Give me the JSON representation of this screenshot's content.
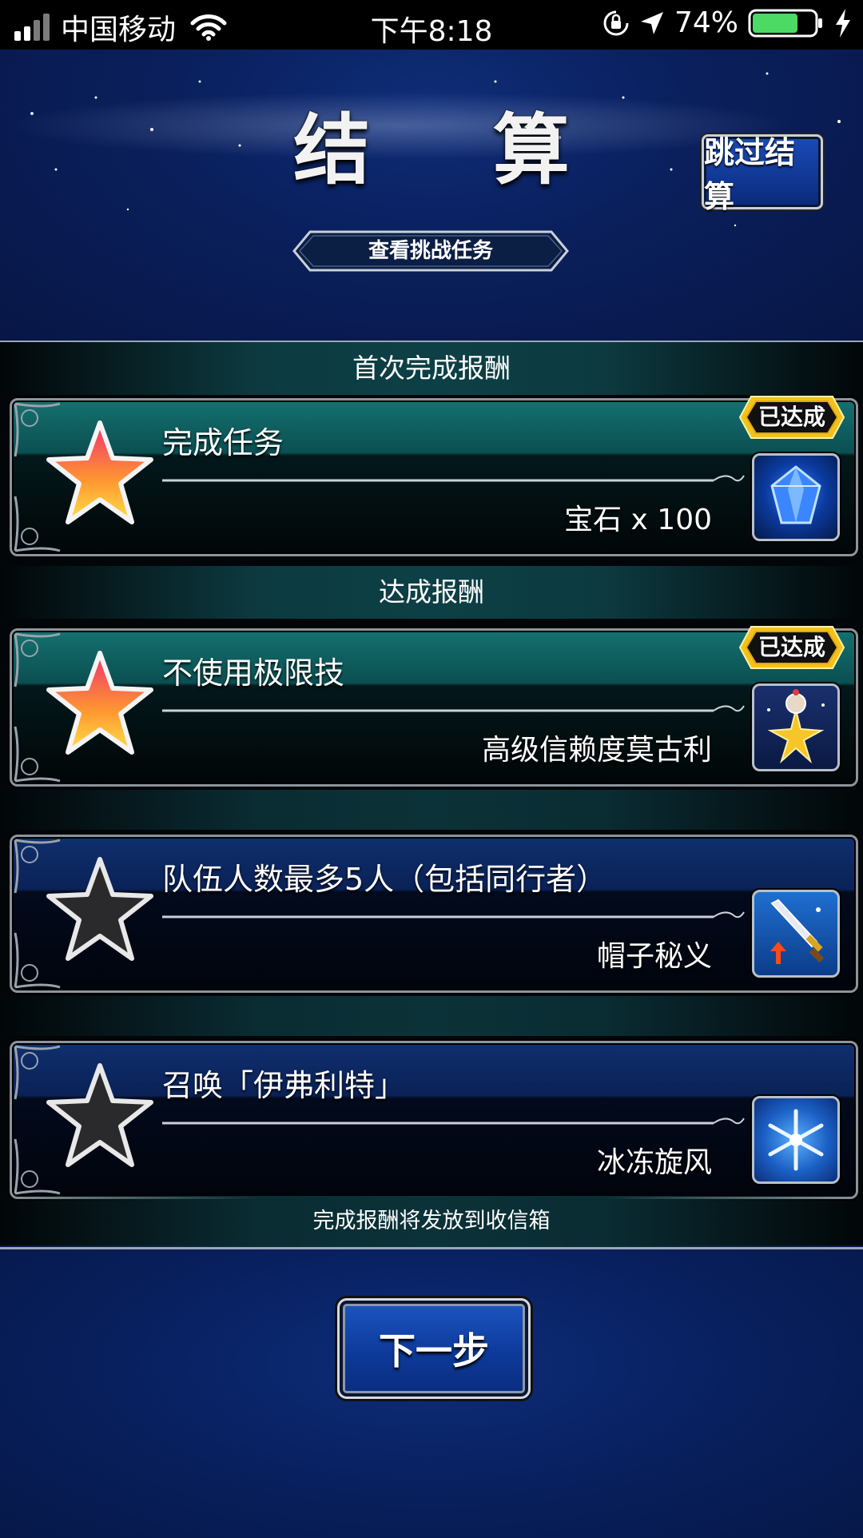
{
  "status_bar": {
    "carrier": "中国移动",
    "time": "下午8:18",
    "battery": "74%",
    "battery_level": 0.74
  },
  "header": {
    "title": "结 算",
    "skip_label": "跳过结算",
    "challenge_label": "查看挑战任务"
  },
  "sections": {
    "first_clear": "首次完成报酬",
    "achievement": "达成报酬"
  },
  "missions": [
    {
      "name": "完成任务",
      "reward": "宝石 x 100",
      "achieved": true,
      "badge": "已达成",
      "icon": "crystal-gem-icon"
    },
    {
      "name": "不使用极限技",
      "reward": "高级信赖度莫古利",
      "achieved": true,
      "badge": "已达成",
      "icon": "moogle-star-icon"
    },
    {
      "name": "队伍人数最多5人（包括同行者）",
      "reward": "帽子秘义",
      "achieved": false,
      "icon": "sword-upgrade-icon"
    },
    {
      "name": "召唤「伊弗利特」",
      "reward": "冰冻旋风",
      "achieved": false,
      "icon": "ice-snowflake-icon"
    }
  ],
  "footer_note": "完成报酬将发放到收信箱",
  "next_label": "下一步",
  "colors": {
    "achieved_card": "#0b4f52",
    "pending_card": "#0a2257",
    "badge_gold": "#f2c21a",
    "star_gold": "#ffd23a",
    "star_pink": "#f0306e"
  }
}
